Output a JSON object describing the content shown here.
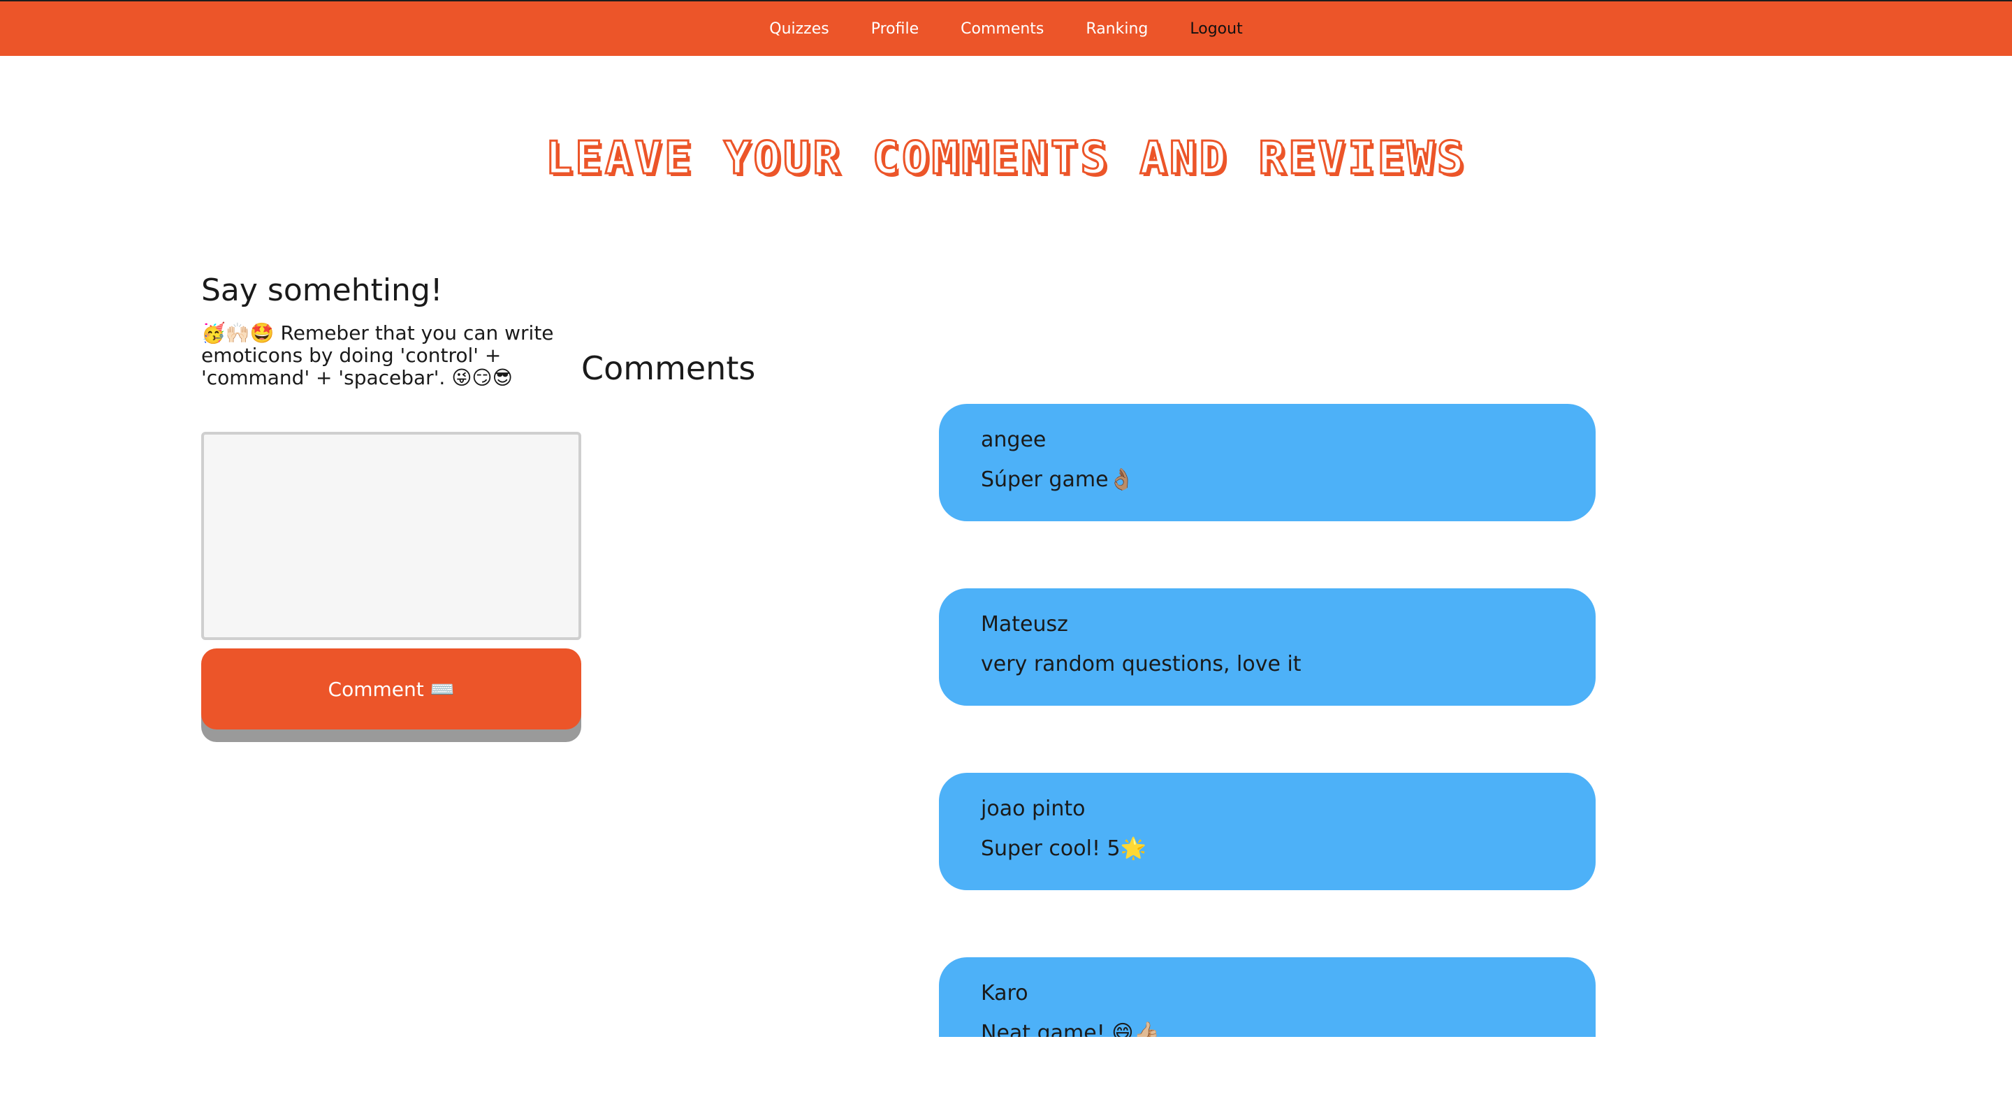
{
  "nav": {
    "items": [
      "Quizzes",
      "Profile",
      "Comments",
      "Ranking"
    ],
    "logout": "Logout"
  },
  "page_title": "Leave your comments and reviews",
  "composer": {
    "heading": "Say somehting!",
    "hint": "🥳🙌🏻🤩 Remeber that you can write emoticons by doing 'control' + 'command' + 'spacebar'. 😜😏😎",
    "textarea_value": "",
    "button_label": "Comment ⌨️"
  },
  "comments": {
    "heading": "Comments",
    "items": [
      {
        "user": "angee",
        "text": "Súper game👌🏽"
      },
      {
        "user": "Mateusz",
        "text": "very random questions, love it"
      },
      {
        "user": "joao pinto",
        "text": "Super cool! 5🌟"
      },
      {
        "user": "Karo",
        "text": "Neat game! 😄👍🏼"
      }
    ]
  },
  "colors": {
    "brand_orange": "#ec5529",
    "comment_blue": "#4db1f8",
    "button_shadow": "#9a9a9a"
  }
}
